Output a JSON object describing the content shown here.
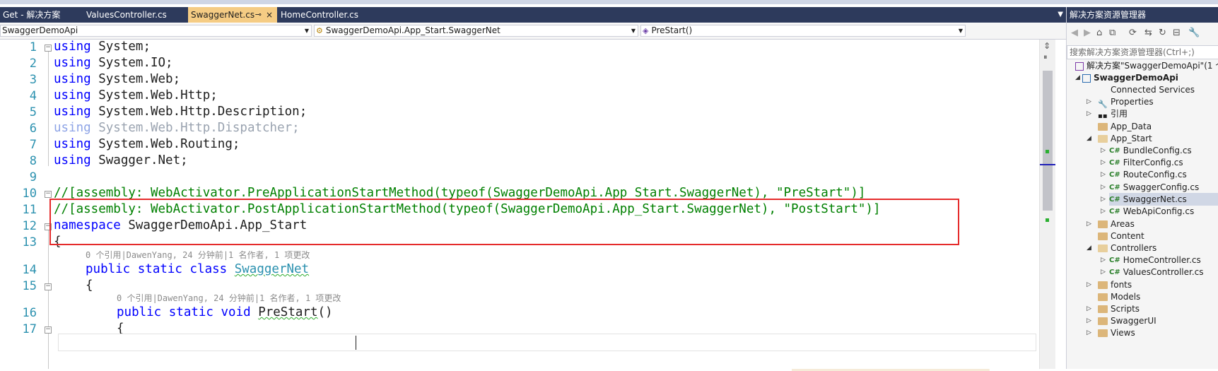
{
  "tabs": {
    "preview_label": "Get - 解决方案",
    "items": [
      {
        "label": "ValuesController.cs"
      },
      {
        "label": "SwaggerNet.cs",
        "active": true
      },
      {
        "label": "HomeController.cs"
      }
    ],
    "pin_glyph": "⊸",
    "close_glyph": "×"
  },
  "navbar": {
    "project": "SwaggerDemoApi",
    "type": "SwaggerDemoApi.App_Start.SwaggerNet",
    "member": "PreStart()"
  },
  "editor": {
    "line_numbers": [
      "1",
      "2",
      "3",
      "4",
      "5",
      "6",
      "7",
      "8",
      "9",
      "10",
      "11",
      "12",
      "13",
      "14",
      "15",
      "16",
      "17"
    ],
    "lines": {
      "l1": {
        "kw": "using",
        "rest": " System;"
      },
      "l2": {
        "kw": "using",
        "rest": " System.IO;"
      },
      "l3": {
        "kw": "using",
        "rest": " System.Web;"
      },
      "l4": {
        "kw": "using",
        "rest": " System.Web.Http;"
      },
      "l5": {
        "kw": "using",
        "rest": " System.Web.Http.Description;"
      },
      "l6": {
        "kw": "using",
        "rest": " System.Web.Http.Dispatcher;"
      },
      "l7": {
        "kw": "using",
        "rest": " System.Web.Routing;"
      },
      "l8": {
        "kw": "using",
        "rest": " Swagger.Net;"
      },
      "l10": "//[assembly: WebActivator.PreApplicationStartMethod(typeof(SwaggerDemoApi.App_Start.SwaggerNet), \"PreStart\")]",
      "l11": "//[assembly: WebActivator.PostApplicationStartMethod(typeof(SwaggerDemoApi.App_Start.SwaggerNet), \"PostStart\")]",
      "l12": {
        "kw": "namespace",
        "rest": " SwaggerDemoApi.App_Start"
      },
      "l13": "{",
      "l14": {
        "kw": "public static class",
        "type": "SwaggerNet"
      },
      "l15": "{",
      "l16": {
        "kw": "public static void",
        "method": "PreStart",
        "rest": "()"
      },
      "l17": "{"
    },
    "lens_class": "0 个引用|DawenYang, 24 分钟前|1 名作者, 1 项更改",
    "lens_method": "0 个引用|DawenYang, 24 分钟前|1 名作者, 1 项更改"
  },
  "solution_explorer": {
    "title": "解决方案资源管理器",
    "search_placeholder": "搜索解决方案资源管理器(Ctrl+;)",
    "solution": "解决方案\"SwaggerDemoApi\"(1 个",
    "project": "SwaggerDemoApi",
    "items": [
      {
        "label": "Connected Services",
        "icon": "connected-services-icon"
      },
      {
        "label": "Properties",
        "icon": "wrench-icon"
      },
      {
        "label": "引用",
        "icon": "references-icon"
      },
      {
        "label": "App_Data",
        "icon": "folder-icon"
      },
      {
        "label": "App_Start",
        "icon": "folder-open-icon"
      },
      {
        "label": "BundleConfig.cs",
        "icon": "csharp-file-icon"
      },
      {
        "label": "FilterConfig.cs",
        "icon": "csharp-file-icon"
      },
      {
        "label": "RouteConfig.cs",
        "icon": "csharp-file-icon"
      },
      {
        "label": "SwaggerConfig.cs",
        "icon": "csharp-file-icon"
      },
      {
        "label": "SwaggerNet.cs",
        "icon": "csharp-file-icon",
        "selected": true
      },
      {
        "label": "WebApiConfig.cs",
        "icon": "csharp-file-icon"
      },
      {
        "label": "Areas",
        "icon": "folder-icon"
      },
      {
        "label": "Content",
        "icon": "folder-icon"
      },
      {
        "label": "Controllers",
        "icon": "folder-open-icon"
      },
      {
        "label": "HomeController.cs",
        "icon": "csharp-file-icon"
      },
      {
        "label": "ValuesController.cs",
        "icon": "csharp-file-icon"
      },
      {
        "label": "fonts",
        "icon": "folder-icon"
      },
      {
        "label": "Models",
        "icon": "folder-icon"
      },
      {
        "label": "Scripts",
        "icon": "folder-icon"
      },
      {
        "label": "SwaggerUI",
        "icon": "folder-icon"
      },
      {
        "label": "Views",
        "icon": "folder-icon"
      }
    ]
  },
  "colors": {
    "keyword": "#0000ff",
    "comment": "#008000",
    "type": "#2b91af",
    "highlight_box": "#e52b2b",
    "active_tab": "#f5cc84",
    "titlebar": "#2d3a5c"
  }
}
